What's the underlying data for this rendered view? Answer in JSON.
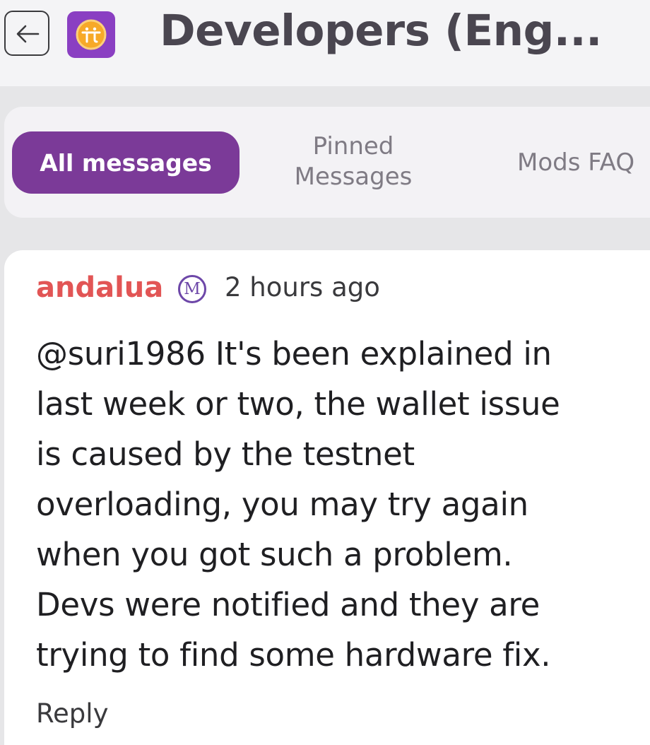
{
  "header": {
    "title": "Developers (Eng...",
    "back_icon": "arrow-left-icon",
    "logo_icon": "pi-network-logo",
    "logo_color": "#8a3fc2"
  },
  "tabs": {
    "all_messages": "All messages",
    "pinned_line1": "Pinned",
    "pinned_line2": "Messages",
    "mods_faq": "Mods FAQ",
    "active_color": "#7b3a98"
  },
  "message": {
    "author": "andalua",
    "author_color": "#e25555",
    "badge": "M",
    "timestamp": "2 hours ago",
    "body_lines": [
      "@suri1986 It's been explained in",
      "last week or two, the wallet issue",
      "is caused by the testnet",
      "overloading, you may try again",
      "when you got such a problem.",
      "Devs were notified and they are",
      "trying to find some hardware fix."
    ],
    "reply_label": "Reply"
  }
}
